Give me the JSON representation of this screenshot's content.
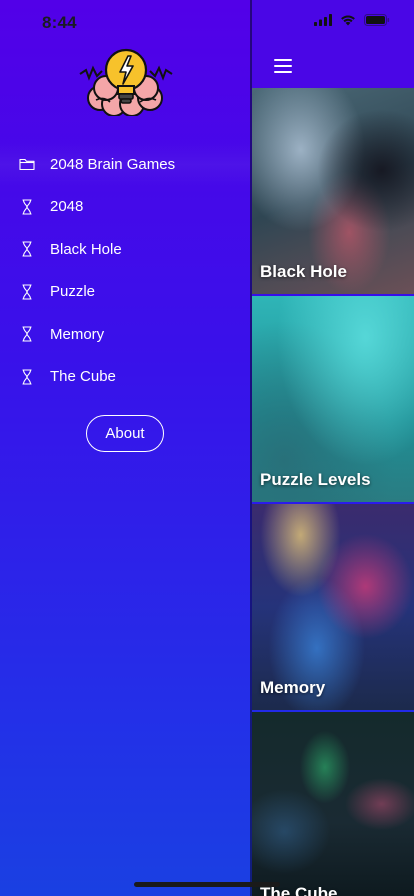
{
  "status_bar": {
    "time": "8:44",
    "icons": [
      "cellular-signal-icon",
      "wifi-icon",
      "battery-icon"
    ]
  },
  "drawer": {
    "logo_icon": "brain-lightbulb-logo",
    "menu": [
      {
        "label": "2048 Brain Games",
        "icon": "folder-icon",
        "active": true
      },
      {
        "label": "2048",
        "icon": "hourglass-icon"
      },
      {
        "label": "Black Hole",
        "icon": "hourglass-icon"
      },
      {
        "label": "Puzzle",
        "icon": "hourglass-icon"
      },
      {
        "label": "Memory",
        "icon": "hourglass-icon"
      },
      {
        "label": "The Cube",
        "icon": "hourglass-icon"
      }
    ],
    "about_label": "About"
  },
  "main": {
    "menu_icon": "hamburger-menu-icon",
    "cards": [
      {
        "label": "Black Hole"
      },
      {
        "label": "Puzzle Levels"
      },
      {
        "label": "Memory"
      },
      {
        "label": "The Cube"
      }
    ]
  },
  "colors": {
    "drawer_top": "#5200e8",
    "drawer_bottom": "#1a40e2",
    "header": "#4a06e6",
    "text": "#ffffff"
  }
}
